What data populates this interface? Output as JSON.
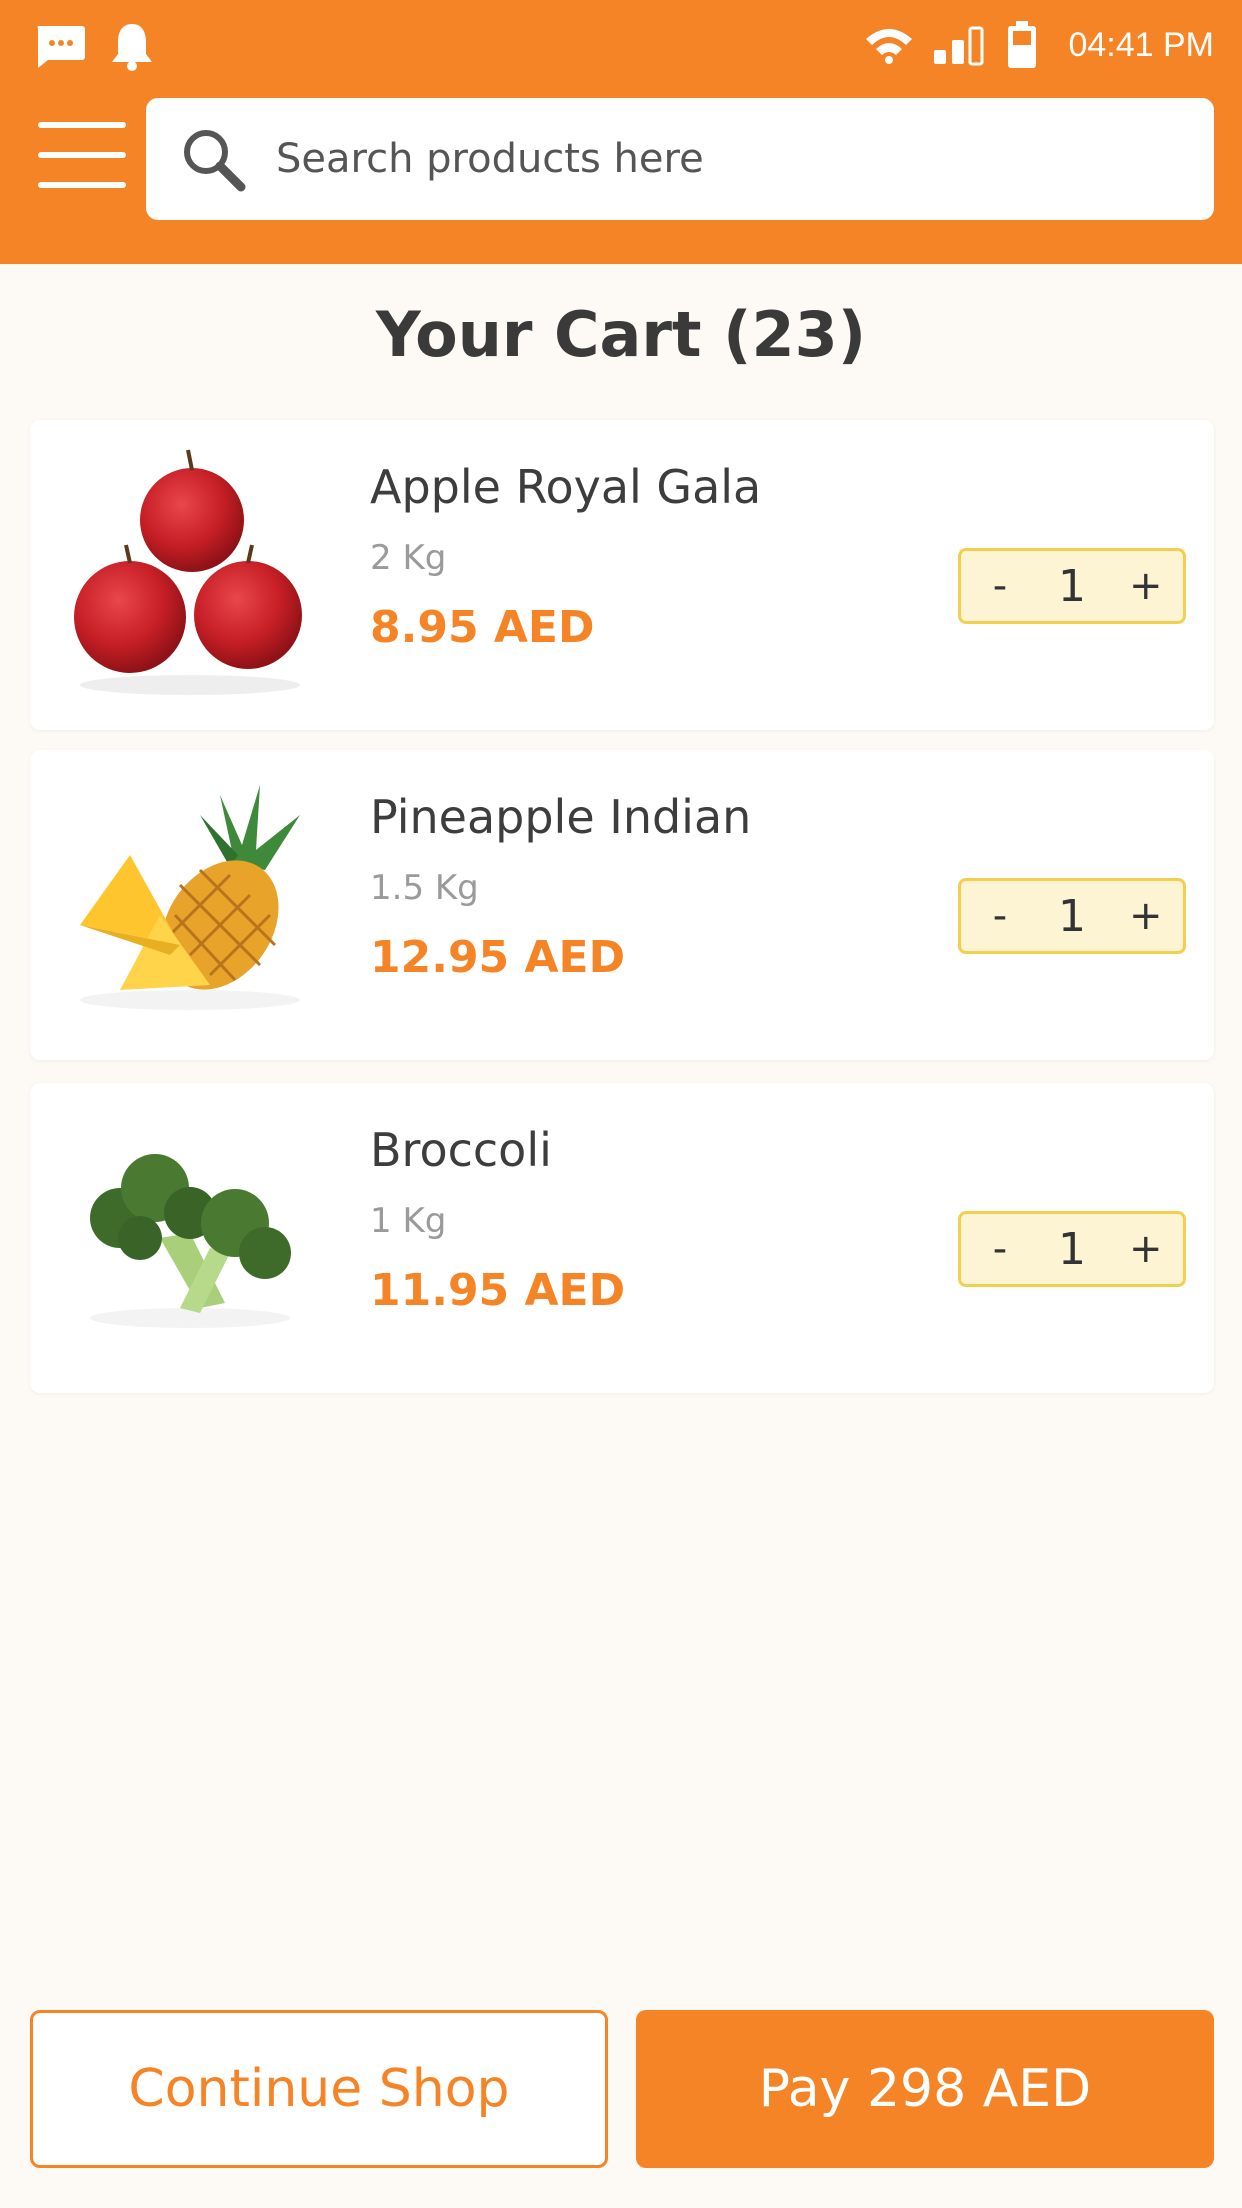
{
  "status_bar": {
    "time": "04:41 PM"
  },
  "search": {
    "placeholder": "Search products here"
  },
  "page": {
    "title": "Your Cart (23)"
  },
  "cart": {
    "items": [
      {
        "name": "Apple Royal Gala",
        "weight": "2 Kg",
        "price": "8.95 AED",
        "quantity": "1",
        "image_icon": "apple-image"
      },
      {
        "name": "Pineapple Indian",
        "weight": "1.5 Kg",
        "price": "12.95 AED",
        "quantity": "1",
        "image_icon": "pineapple-image"
      },
      {
        "name": "Broccoli",
        "weight": "1 Kg",
        "price": "11.95 AED",
        "quantity": "1",
        "image_icon": "broccoli-image"
      }
    ],
    "stepper": {
      "minus": "-",
      "plus": "+"
    }
  },
  "footer": {
    "continue_label": "Continue Shop",
    "pay_label": "Pay 298 AED"
  },
  "colors": {
    "accent": "#f58426",
    "stepper_bg": "#fdf4d4",
    "stepper_border": "#f3cf4f",
    "background": "#fdfaf6"
  }
}
